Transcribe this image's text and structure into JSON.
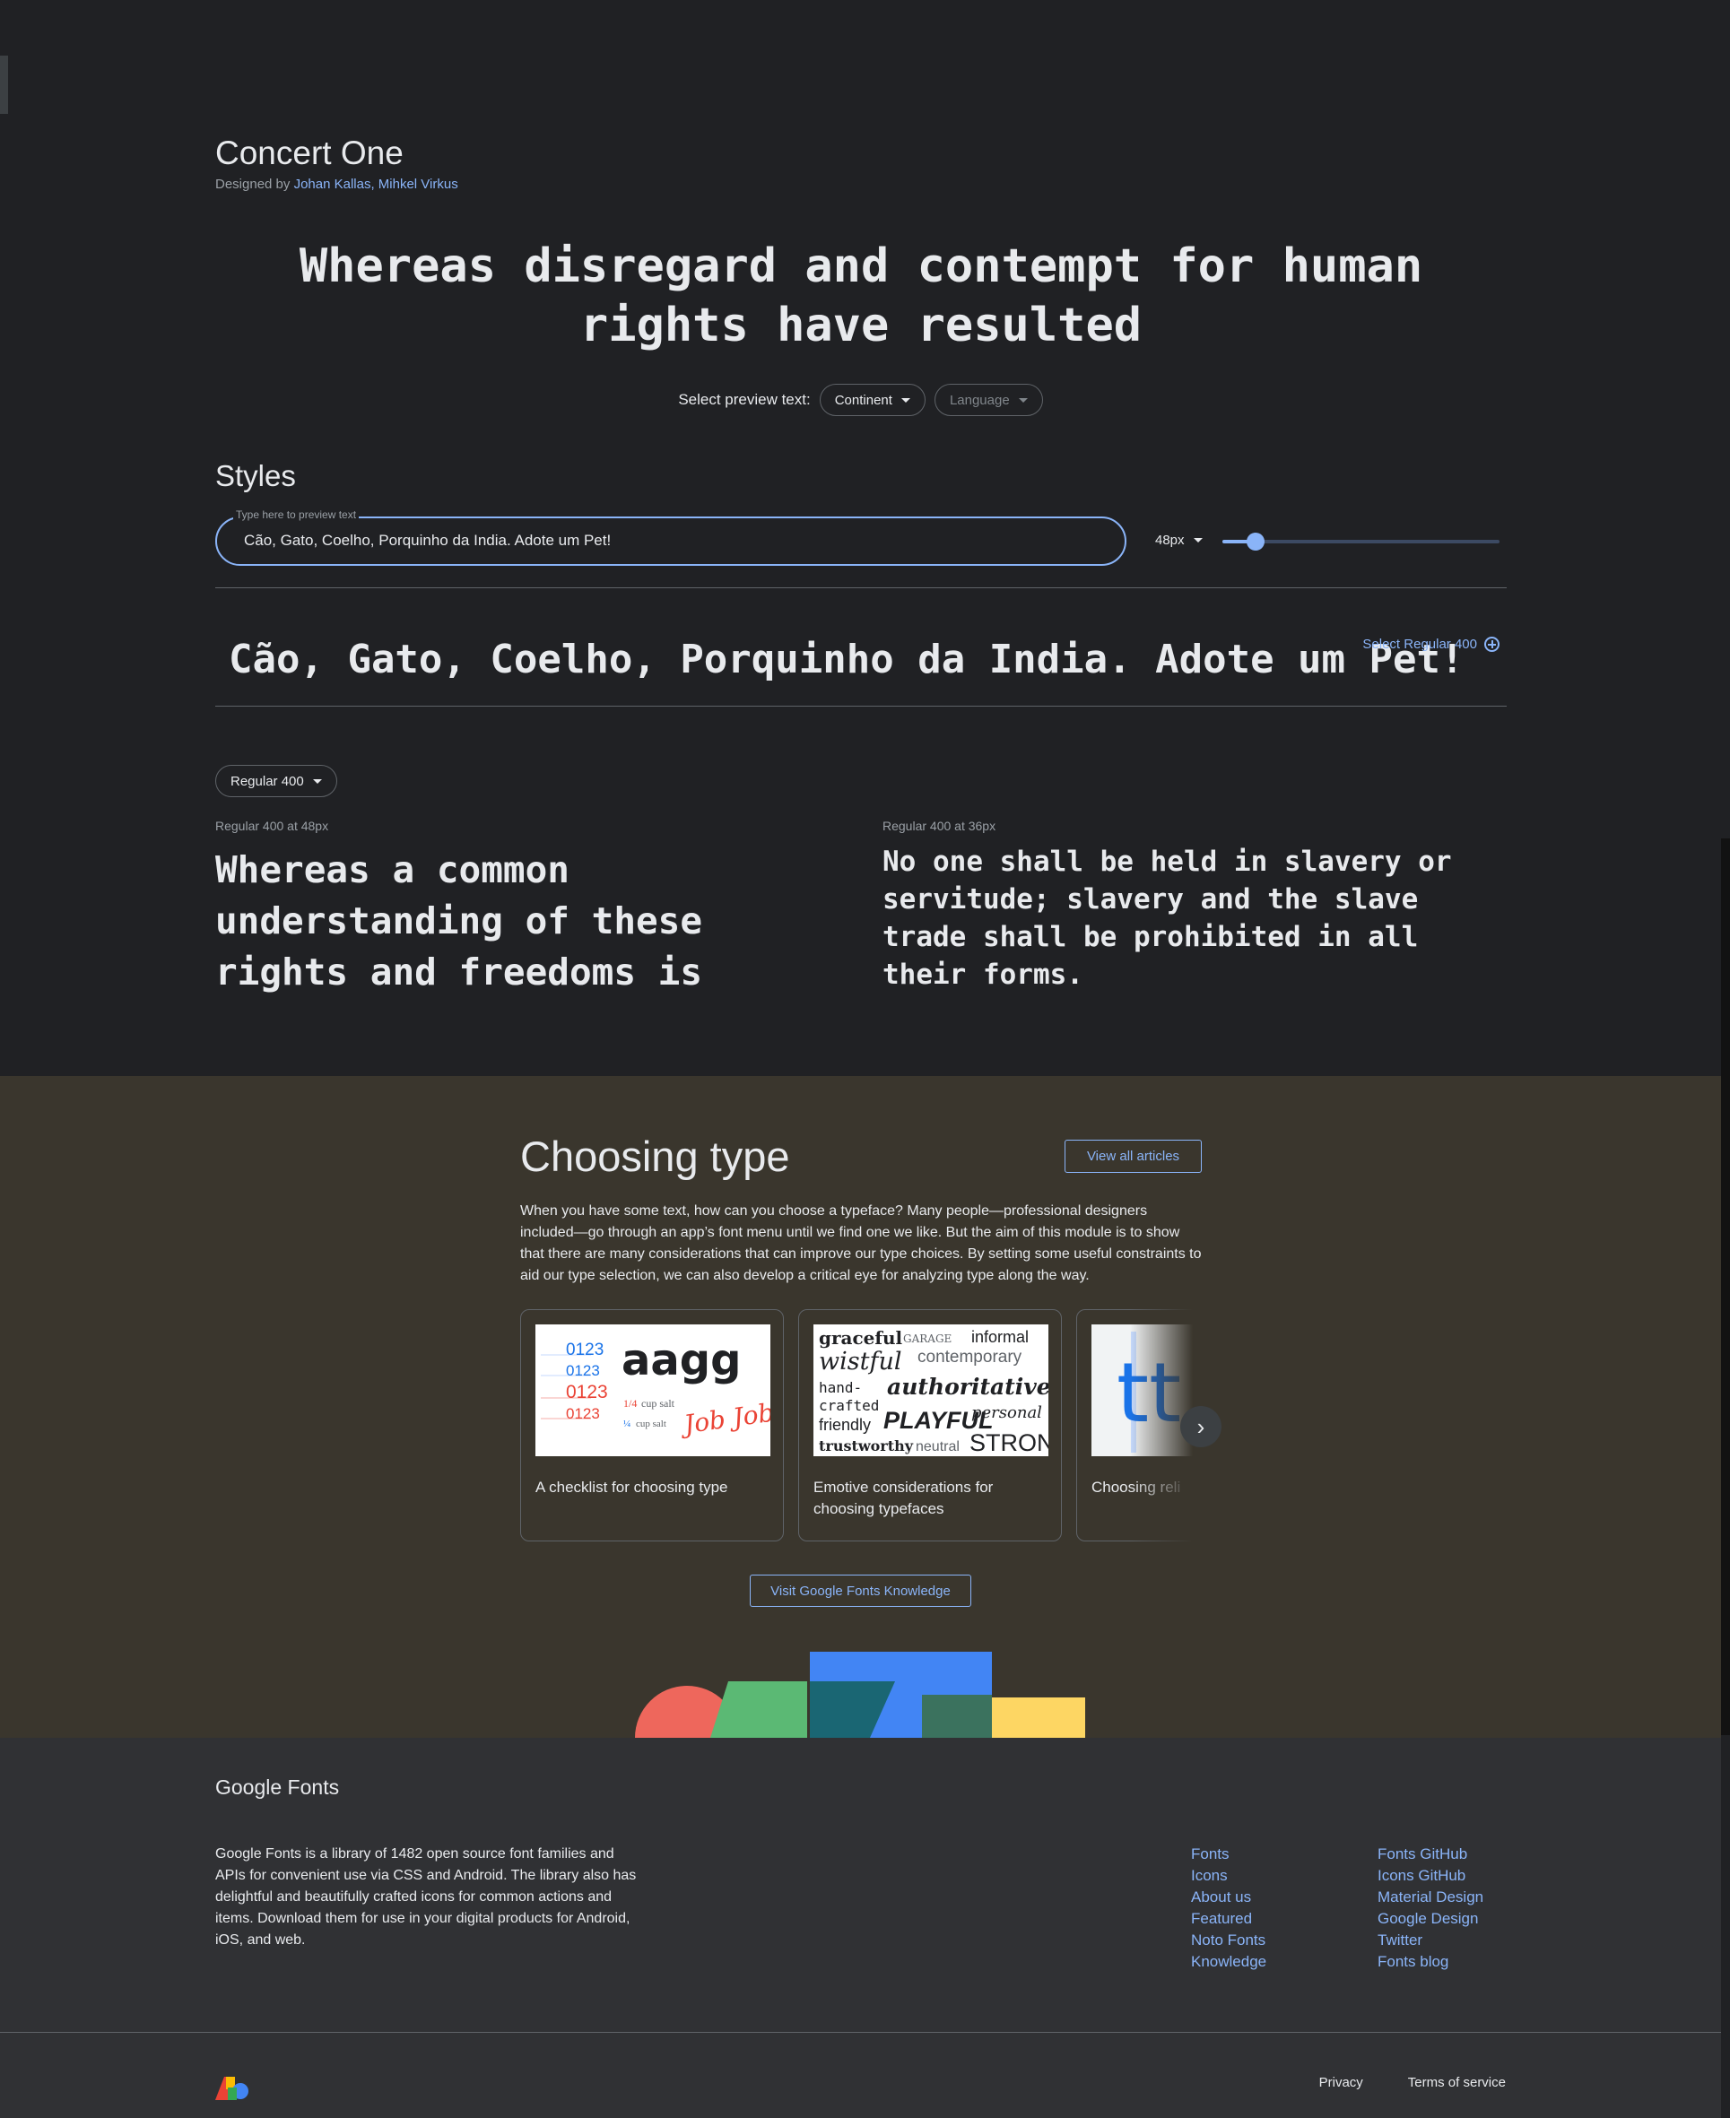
{
  "font": {
    "name": "Concert One",
    "designed_by_prefix": "Designed by ",
    "designers": "Johan Kallas, Mihkel Virkus"
  },
  "hero_text": "Whereas disregard and contempt for human rights have resulted",
  "preview": {
    "label": "Select preview text:",
    "continent": "Continent",
    "language": "Language"
  },
  "styles": {
    "heading": "Styles",
    "input_label": "Type here to preview text",
    "input_value": "Cão, Gato, Coelho, Porquinho da India. Adote um Pet!",
    "size": "48px",
    "size_level_fraction": 0.12,
    "row_preview": "Cão, Gato, Coelho, Porquinho da India. Adote um Pet!",
    "select_style": "Select Regular 400"
  },
  "samples": {
    "weight_select": "Regular 400",
    "left_caption": "Regular 400 at 48px",
    "left_text": "Whereas a common understanding of these rights and freedoms is",
    "right_caption": "Regular 400 at 36px",
    "right_text": "No one shall be held in slavery or servitude; slavery and the slave trade shall be prohibited in all their forms."
  },
  "choosing": {
    "heading": "Choosing type",
    "view_all": "View all articles",
    "body": "When you have some text, how can you choose a typeface? Many people—professional designers included—go through an app’s font menu until we find one we like. But the aim of this module is to show that there are many considerations that can improve our type choices. By setting some useful constraints to aid our type selection, we can also develop a critical eye for analyzing type along the way.",
    "cards": [
      {
        "title": "A checklist for choosing type"
      },
      {
        "title": "Emotive considerations for choosing typefaces"
      },
      {
        "title": "Choosing reli"
      }
    ],
    "card1_thumb": {
      "nums": [
        "0123",
        "0123",
        "0123",
        "0123"
      ],
      "big": "aagg",
      "fraction1": "1/4",
      "cup1": "cup salt",
      "fraction2": "¼",
      "cup2": "cup salt",
      "script": "Job Job"
    },
    "card2_thumb": {
      "words": [
        "graceful",
        "GARAGE",
        "informal",
        "wistful",
        "contemporary",
        "hand-",
        "crafted",
        "authoritative",
        "friendly",
        "PLAYFUL",
        "personal",
        "trustworthy",
        "neutral",
        "STRONG"
      ]
    },
    "card3_thumb": {
      "letters": "tt"
    },
    "next_icon": "chevron-right-icon",
    "visit": "Visit Google Fonts Knowledge"
  },
  "footer": {
    "brand": "Google Fonts",
    "description": "Google Fonts is a library of 1482 open source font families and APIs for convenient use via CSS and Android. The library also has delightful and beautifully crafted icons for common actions and items. Download them for use in your digital products for Android, iOS, and web.",
    "col1": [
      "Fonts",
      "Icons",
      "About us",
      "Featured",
      "Noto Fonts",
      "Knowledge"
    ],
    "col2": [
      "Fonts GitHub",
      "Icons GitHub",
      "Material Design",
      "Google Design",
      "Twitter",
      "Fonts blog"
    ],
    "privacy": "Privacy",
    "terms": "Terms of service"
  },
  "colors": {
    "accent": "#8ab4f8",
    "background": "#202124",
    "choosing_bg": "#3a362d",
    "footer_bg": "#303134"
  }
}
